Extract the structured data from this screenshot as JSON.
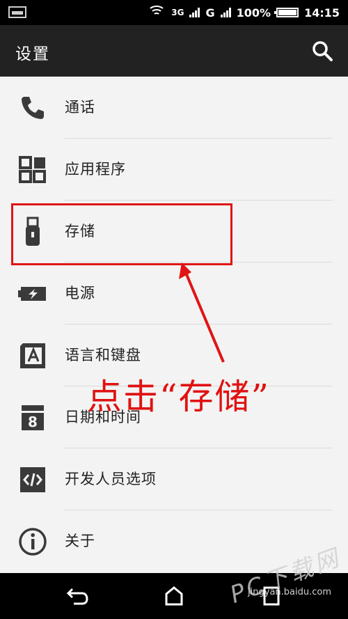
{
  "statusbar": {
    "net_type": "3G",
    "sim2_type": "G",
    "battery_percent": "100%",
    "time": "14:15"
  },
  "actionbar": {
    "title": "设置"
  },
  "settings": [
    {
      "label": "通话",
      "icon": "phone-icon"
    },
    {
      "label": "应用程序",
      "icon": "apps-grid-icon"
    },
    {
      "label": "存储",
      "icon": "usb-storage-icon"
    },
    {
      "label": "电源",
      "icon": "battery-icon"
    },
    {
      "label": "语言和键盘",
      "icon": "language-keyboard-icon"
    },
    {
      "label": "日期和时间",
      "icon": "calendar-icon"
    },
    {
      "label": "开发人员选项",
      "icon": "developer-code-icon"
    },
    {
      "label": "关于",
      "icon": "info-icon"
    }
  ],
  "annotation": {
    "caption": "点击“存储”"
  },
  "watermark": {
    "site": "PC下载网",
    "sub": "jingyan.baidu.com"
  }
}
